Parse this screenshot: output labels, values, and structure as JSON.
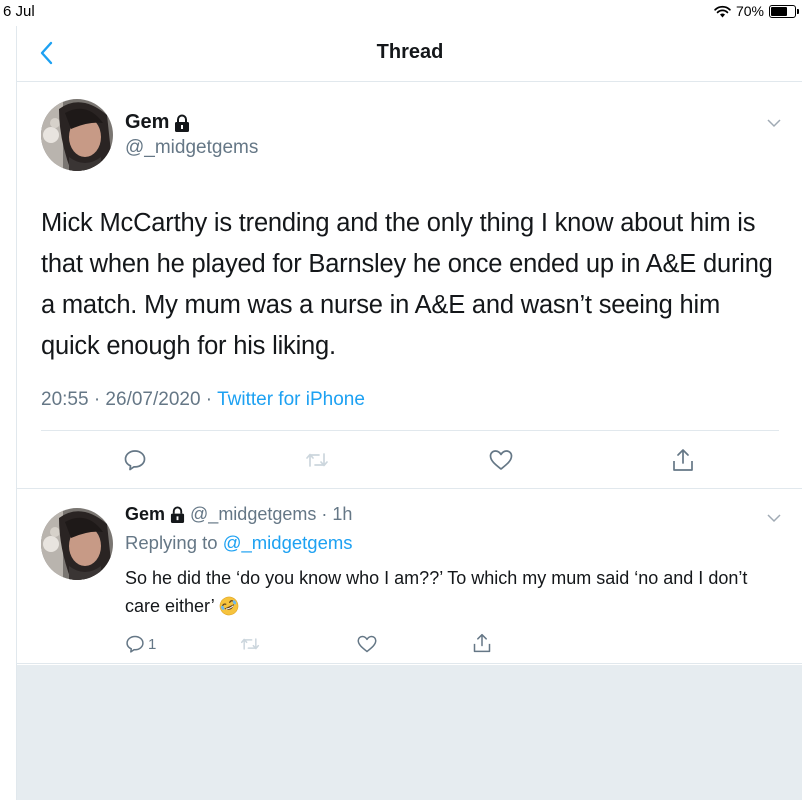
{
  "status_bar": {
    "date": "6 Jul",
    "battery": "70%",
    "battery_level": 0.7,
    "icons": [
      "wifi-icon",
      "battery-icon"
    ]
  },
  "nav": {
    "title": "Thread",
    "back_icon": "chevron-left-icon"
  },
  "main_tweet": {
    "name": "Gem",
    "handle": "@_midgetgems",
    "text": "Mick McCarthy is trending and the only thing I know about him is that when he played for Barnsley he once ended up in A&E during a match. My mum was a nurse in A&E and wasn’t seeing him quick enough for his liking.",
    "timestamp": "20:55 · 26/07/2020 · ",
    "source": "Twitter for iPhone",
    "actions": [
      "reply-icon",
      "retweet-icon",
      "like-icon",
      "share-icon"
    ]
  },
  "reply_tweet": {
    "name": "Gem",
    "handle_time": "@_midgetgems · 1h",
    "replying_prefix": "Replying to ",
    "replying_handle": "@_midgetgems",
    "text": "So he did the ‘do you know who I am??’ To which my mum said ‘no and I don’t care either’",
    "emoji": "rolling-on-floor-laughing-emoji",
    "reply_count": "1"
  },
  "colors": {
    "accent": "#1da1f2",
    "text_primary": "#14171a",
    "text_secondary": "#657786",
    "divider": "#e1e8ed",
    "background_grey": "#e6ecf0"
  }
}
